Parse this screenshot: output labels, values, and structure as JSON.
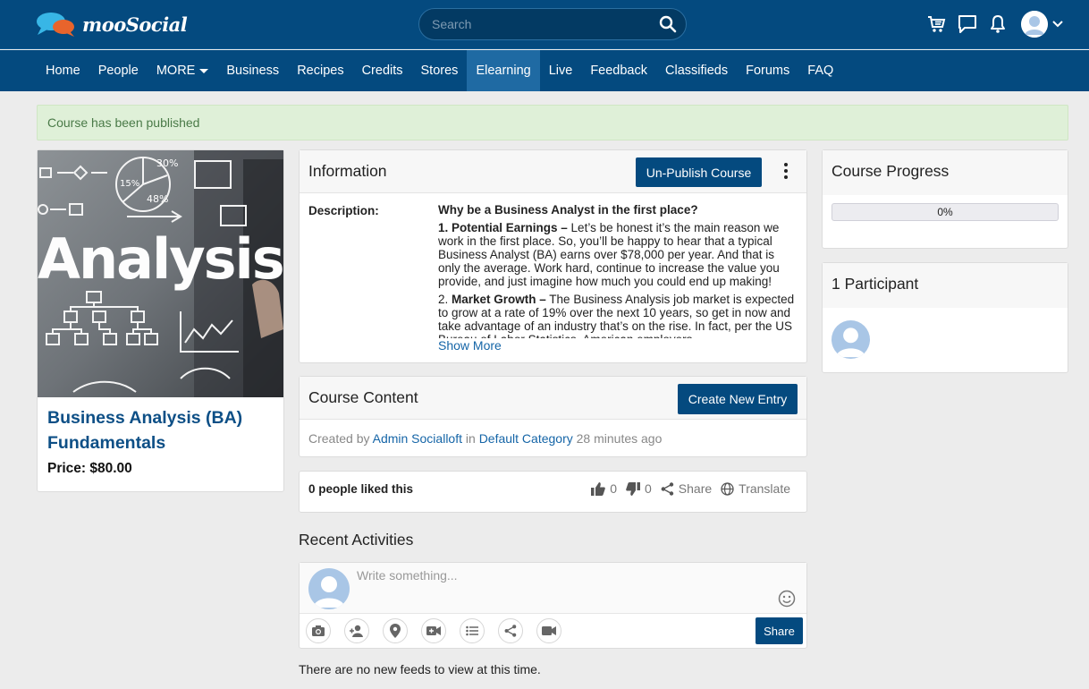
{
  "brand": {
    "name": "mooSocial"
  },
  "search": {
    "placeholder": "Search"
  },
  "top_icons": [
    "cart-icon",
    "chat-icon",
    "bell-icon",
    "user-avatar",
    "chevron-down-icon"
  ],
  "nav": {
    "items": [
      "Home",
      "People",
      "MORE",
      "Business",
      "Recipes",
      "Credits",
      "Stores",
      "Elearning",
      "Live",
      "Feedback",
      "Classifieds",
      "Forums",
      "FAQ"
    ],
    "active": "Elearning"
  },
  "alert": {
    "text": "Course has been published"
  },
  "course": {
    "title": "Business Analysis (BA) Fundamentals",
    "price": "Price: $80.00",
    "image_words": {
      "word": "Analysis",
      "pct1": "30%",
      "pct2": "15%",
      "pct3": "48%"
    }
  },
  "info": {
    "title": "Information",
    "unpublish_label": "Un-Publish Course",
    "description_label": "Description:",
    "question": "Why be a Business Analyst in the first place?",
    "p1_bold": "1. Potential Earnings –",
    "p1_text": " Let’s be honest it’s the main reason we work in the first place. So, you’ll be happy to hear that a typical Business Analyst (BA) earns over $78,000 per year. And that is only the average. Work hard, continue to increase the value you provide, and just imagine how much you could end up making!",
    "p2_num": "2. ",
    "p2_bold": "Market Growth –",
    "p2_text": " The Business Analysis job market is expected to grow at a rate of 19% over the next 10 years, so get in now and take advantage of an industry that’s on the rise. In fact, per the US Bureau of Labor Statistics, American employers",
    "show_more": "Show More"
  },
  "content": {
    "title": "Course Content",
    "create_label": "Create New Entry",
    "created_by": "Created by",
    "author": "Admin Socialloft",
    "in_word": "in",
    "category": "Default Category",
    "time": "28 minutes ago"
  },
  "likes": {
    "text": "0 people liked this",
    "like_count": "0",
    "dislike_count": "0",
    "share_label": "Share",
    "translate_label": "Translate"
  },
  "activities": {
    "title": "Recent Activities",
    "placeholder": "Write something...",
    "share_label": "Share",
    "no_feeds": "There are no new feeds to view at this time."
  },
  "progress": {
    "title": "Course Progress",
    "value": 0,
    "label": "0%"
  },
  "participants": {
    "title": "1 Participant"
  },
  "colors": {
    "brand": "#044a7f",
    "nav_active": "#1f6aa3",
    "link": "#1565a7",
    "alert_bg": "#dff0d8",
    "alert_text": "#4a7a48"
  }
}
